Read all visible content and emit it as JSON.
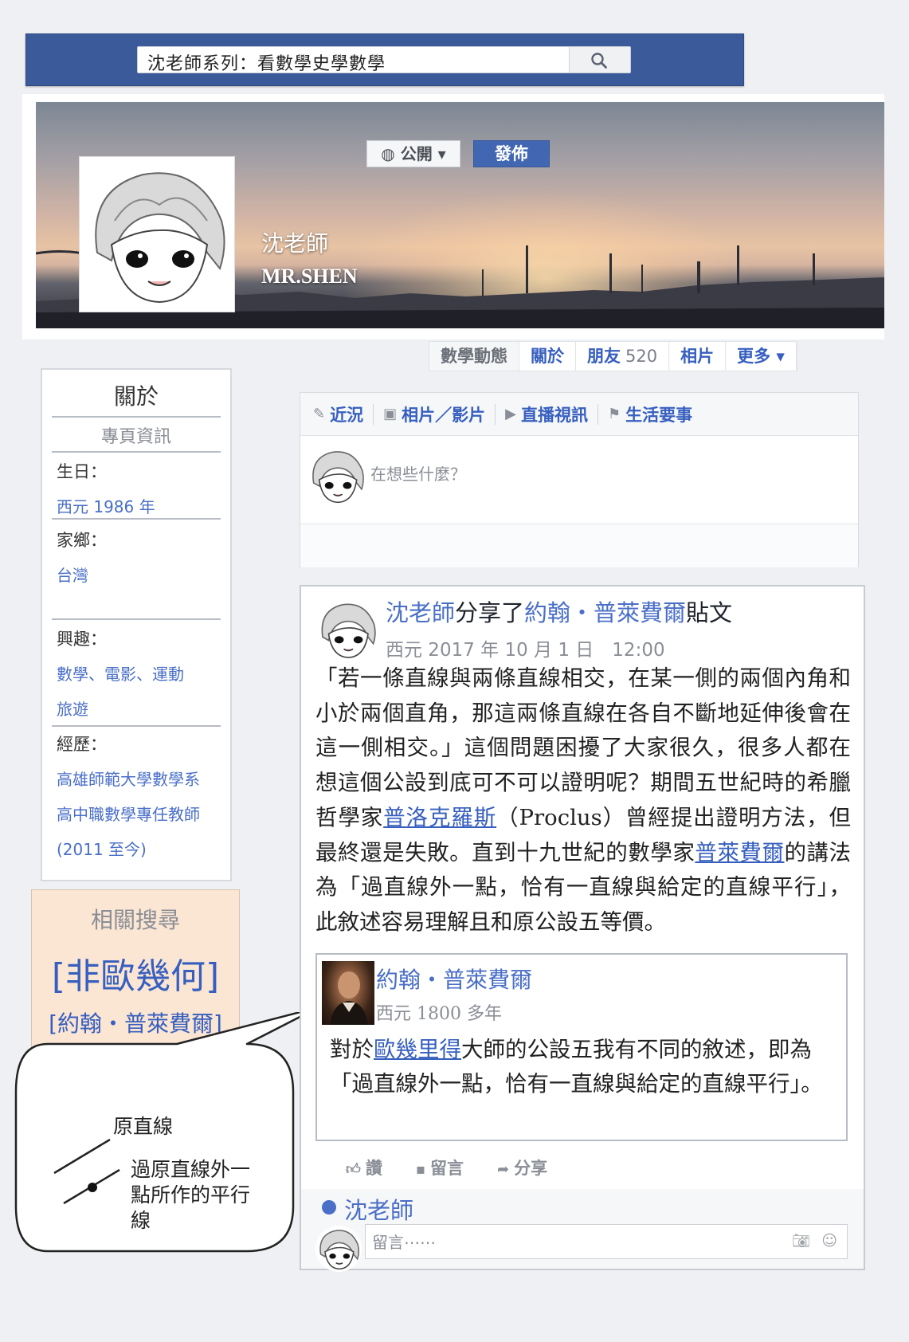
{
  "search": {
    "query": "沈老師系列：看數學史學數學"
  },
  "cover": {
    "name": "沈老師",
    "name_en": "MR.SHEN"
  },
  "nav": {
    "title": "數學動態",
    "tabs": [
      {
        "label": "關於"
      },
      {
        "label": "朋友",
        "count": "520"
      },
      {
        "label": "相片"
      },
      {
        "label": "更多 ▾"
      }
    ]
  },
  "about": {
    "title": "關於",
    "subtitle": "專頁資訊",
    "birthday_label": "生日：",
    "birthday": "西元 1986 年",
    "hometown_label": "家鄉：",
    "hometown": "台灣",
    "interests_label": "興趣：",
    "interests": [
      "數學、電影、運動",
      "旅遊"
    ],
    "experience_label": "經歷：",
    "experience": [
      "高雄師範大學數學系",
      "高中職數學專任教師",
      "(2011 至今)"
    ]
  },
  "related": {
    "title": "相關搜尋",
    "main": "[非歐幾何]",
    "sub": "[約翰・普萊費爾]"
  },
  "composer": {
    "tabs": [
      {
        "icon": "pencil-icon",
        "label": "近況"
      },
      {
        "icon": "photo-icon",
        "label": "相片／影片"
      },
      {
        "icon": "video-icon",
        "label": "直播視訊"
      },
      {
        "icon": "flag-icon",
        "label": "生活要事"
      }
    ],
    "placeholder": "在想些什麼？",
    "privacy": "公開",
    "post_button": "發佈"
  },
  "post": {
    "author": "沈老師",
    "shared_text": "分享了",
    "source": "約翰・普萊費爾",
    "suffix": "貼文",
    "time": "西元 2017 年 10 月 1 日　12:00",
    "body_1": "「若一條直線與兩條直線相交，在某一側的兩個內角和小於兩個直角，那這兩條直線在各自不斷地延伸後會在這一側相交。」這個問題困擾了大家很久，很多人都在想這個公設到底可不可以證明呢？期間五世紀時的希臘哲學家",
    "body_link_1": "普洛克羅斯",
    "body_2": "（Proclus）曾經提出證明方法，但最終還是失敗。直到十九世紀的數學家",
    "body_link_2": "普萊費爾",
    "body_3": "的講法為「過直線外一點，恰有一直線與給定的直線平行」，此敘述容易理解且和原公設五等價。",
    "shared_card": {
      "name": "約翰・普萊費爾",
      "time": "西元 1800 多年",
      "text_1": "對於",
      "text_link": "歐幾里得",
      "text_2": "大師的公設五我有不同的敘述，即為「過直線外一點，恰有一直線與給定的直線平行」。"
    },
    "actions": [
      {
        "icon": "thumbs-up-icon",
        "label": "讚"
      },
      {
        "icon": "comment-icon",
        "label": "留言"
      },
      {
        "icon": "share-icon",
        "label": "分享"
      }
    ],
    "commenter": "沈老師",
    "comment_placeholder": "留言⋯⋯"
  },
  "callout": {
    "title": "原直線",
    "desc": "過原直線外一點所作的平行線"
  },
  "colors": {
    "brand": "#3b5a9a",
    "link": "#365fbf",
    "related_bg": "#fbe5d3",
    "post_button": "#4267b2"
  }
}
